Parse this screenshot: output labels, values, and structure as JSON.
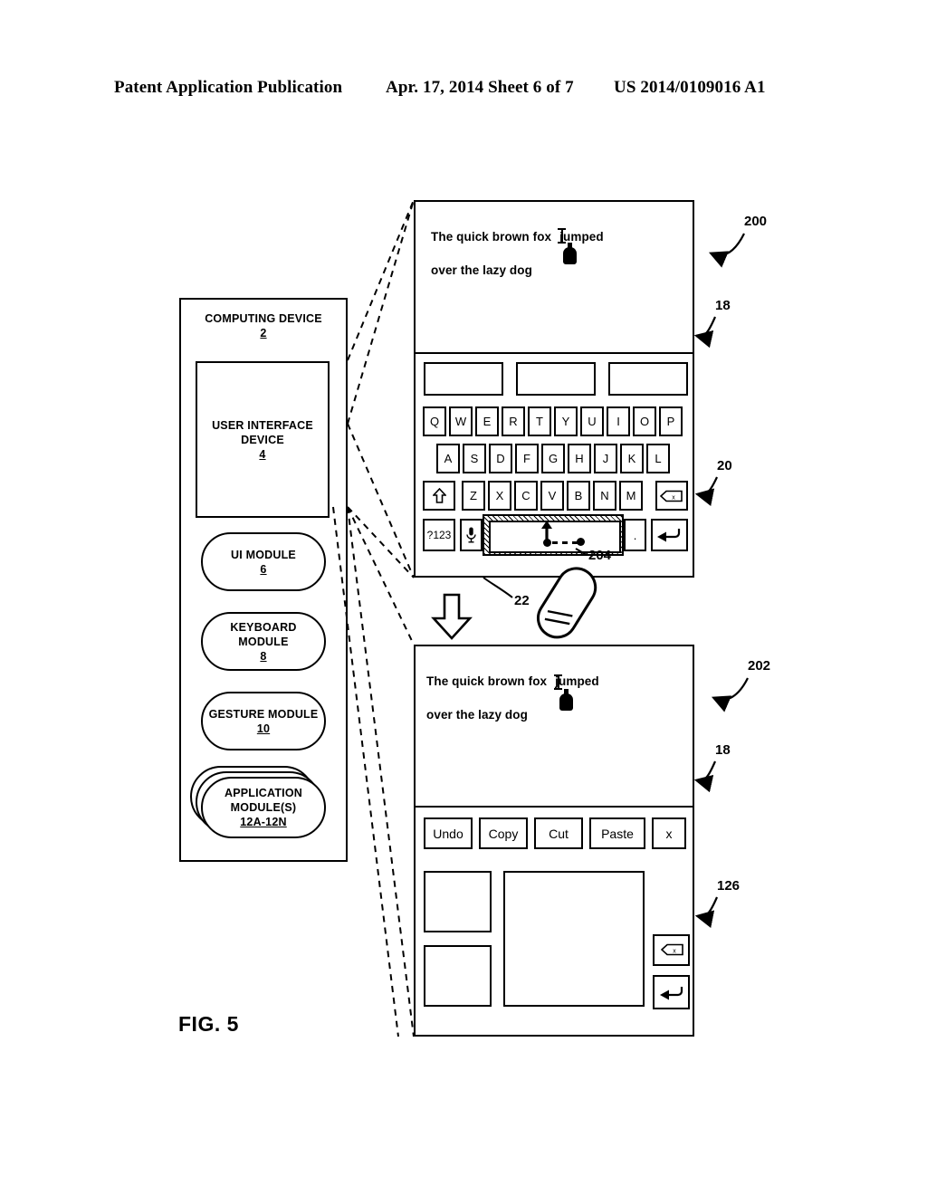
{
  "header": {
    "left": "Patent Application Publication",
    "middle": "Apr. 17, 2014  Sheet 6 of 7",
    "right": "US 2014/0109016 A1"
  },
  "figure": {
    "label": "FIG. 5"
  },
  "block_diagram": {
    "title": "COMPUTING DEVICE",
    "title_num": "2",
    "ui_device": {
      "label_line1": "USER INTERFACE",
      "label_line2": "DEVICE",
      "num": "4"
    },
    "modules": [
      {
        "label_line1": "UI MODULE",
        "label_line2": "",
        "num": "6"
      },
      {
        "label_line1": "KEYBOARD",
        "label_line2": "MODULE",
        "num": "8"
      },
      {
        "label_line1": "GESTURE MODULE",
        "label_line2": "",
        "num": "10"
      },
      {
        "label_line1": "APPLICATION",
        "label_line2": "MODULE(S)",
        "num": "12A-12N"
      }
    ]
  },
  "device_200": {
    "ref": "200",
    "text_area": {
      "ref": "18",
      "line1": "The quick brown fox",
      "line1b": "jumped",
      "line2": "over the lazy dog"
    },
    "keyboard": {
      "ref": "20",
      "suggestions": [
        "",
        "",
        ""
      ],
      "row1": [
        "Q",
        "W",
        "E",
        "R",
        "T",
        "Y",
        "U",
        "I",
        "O",
        "P"
      ],
      "row2": [
        "A",
        "S",
        "D",
        "F",
        "G",
        "H",
        "J",
        "K",
        "L"
      ],
      "row3": [
        "Z",
        "X",
        "C",
        "V",
        "B",
        "N",
        "M"
      ],
      "shift_key": "shift-icon",
      "backspace_key": "backspace-icon",
      "numbers_key": "?123",
      "mic_key": "microphone-icon",
      "space_key": "",
      "period_key": ".",
      "enter_key": "enter-icon",
      "space_region_ref": "22",
      "gesture_ref": "204"
    }
  },
  "device_202": {
    "ref": "202",
    "text_area": {
      "ref": "18",
      "line1": "The quick brown fox",
      "line1b": "jumped",
      "line2": "over the lazy dog"
    },
    "edit_menu": {
      "ref": "126",
      "buttons": [
        "Undo",
        "Copy",
        "Cut",
        "Paste",
        "x"
      ],
      "backspace_key": "backspace-icon",
      "enter_key": "enter-icon"
    }
  }
}
